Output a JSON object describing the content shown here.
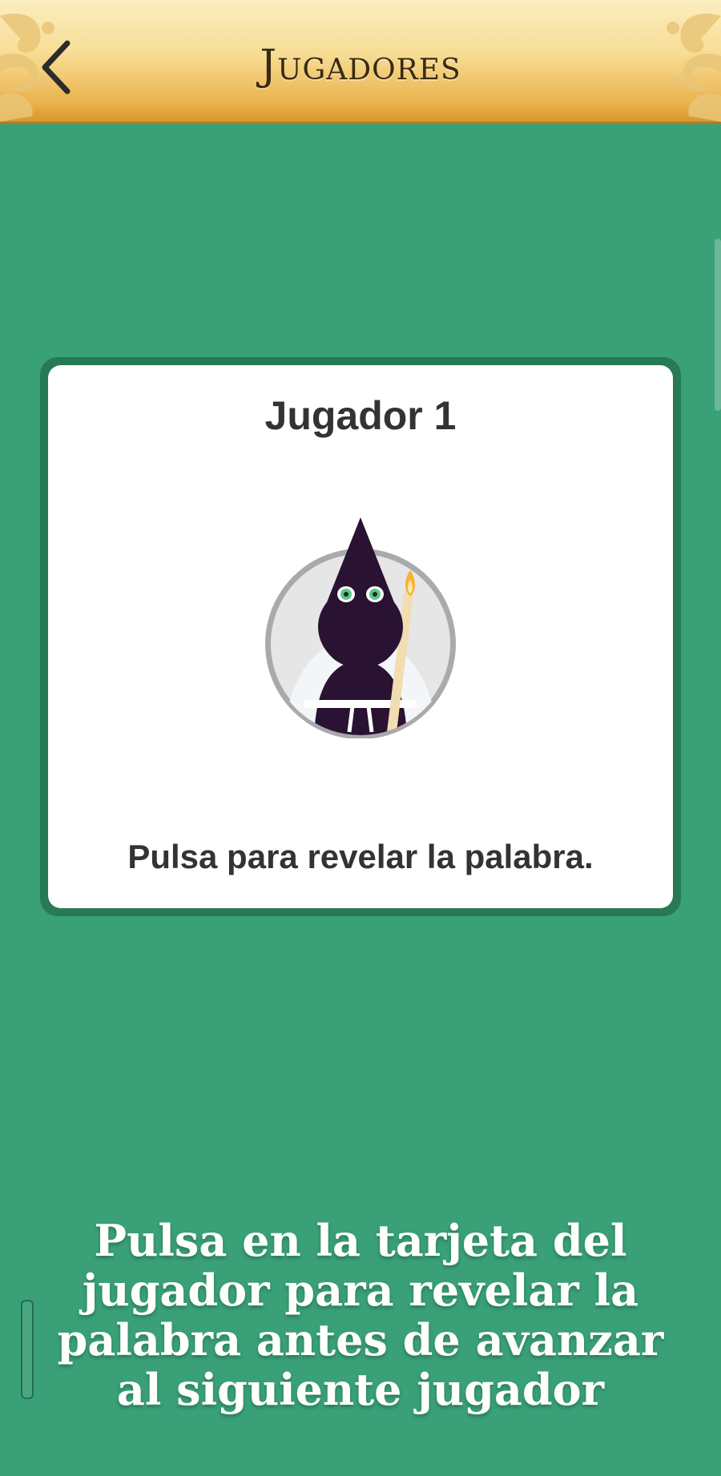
{
  "header": {
    "title": "Jugadores",
    "back_icon": "chevron-left-icon"
  },
  "card": {
    "player_name": "Jugador 1",
    "avatar_icon": "hooded-penitent-avatar",
    "hint": "Pulsa para revelar la palabra."
  },
  "instruction": "Pulsa en la tarjeta del jugador para revelar la palabra antes de avanzar al siguiente jugador",
  "colors": {
    "background": "#39a077",
    "card_border": "#287a57",
    "header_gold": "#f7dc93",
    "text_dark": "#333333"
  }
}
